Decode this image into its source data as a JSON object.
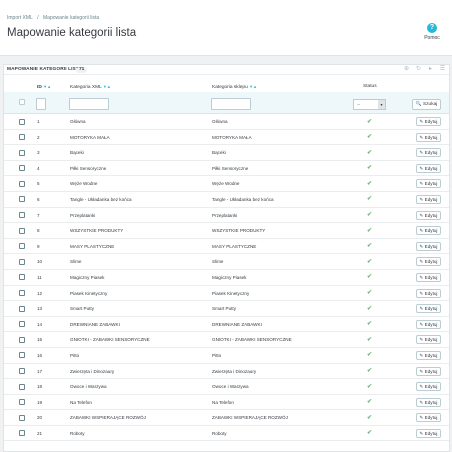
{
  "breadcrumb": [
    "Import XML",
    "/",
    "Mapowanie kategorii lista"
  ],
  "page_title": "Mapowanie kategorii lista",
  "help_label": "Pomoc",
  "panel": {
    "title": "MAPOWANIE KATEGORII LISTA",
    "count": "71"
  },
  "headers": {
    "id": "ID",
    "xml": "Kategoria XML",
    "shop": "Kategoria sklepu",
    "status": "Status",
    "sort_down": "▼",
    "sort_up": "▲"
  },
  "filter": {
    "status_value": "--",
    "search_label": "Szukaj"
  },
  "edit_label": "Edytuj",
  "colors": {
    "accent": "#25b9d7",
    "check": "#70b580"
  },
  "rows": [
    {
      "id": "1",
      "xml": "Główna",
      "shop": "Główna"
    },
    {
      "id": "2",
      "xml": "MOTORYKA MAŁA",
      "shop": "MOTORYKA MAŁA"
    },
    {
      "id": "3",
      "xml": "Bąceki",
      "shop": "Bąceki"
    },
    {
      "id": "4",
      "xml": "Piłki Sensoryczne",
      "shop": "Piłki Sensoryczne"
    },
    {
      "id": "5",
      "xml": "Węże Wodne",
      "shop": "Węże Wodne"
    },
    {
      "id": "6",
      "xml": "Tangle - Układanka bez końca",
      "shop": "Tangle - Układanka bez końca"
    },
    {
      "id": "7",
      "xml": "Przeplatanki",
      "shop": "Przeplatanki"
    },
    {
      "id": "8",
      "xml": "WSZYSTKIE PRODUKTY",
      "shop": "WSZYSTKIE PRODUKTY"
    },
    {
      "id": "9",
      "xml": "MASY PLASTYCZNE",
      "shop": "MASY PLASTYCZNE"
    },
    {
      "id": "10",
      "xml": "Slime",
      "shop": "Slime"
    },
    {
      "id": "11",
      "xml": "Magiczny Piasek",
      "shop": "Magiczny Piasek"
    },
    {
      "id": "12",
      "xml": "Piasek Kinetyczny",
      "shop": "Piasek Kinetyczny"
    },
    {
      "id": "13",
      "xml": "Smart Putty",
      "shop": "Smart Putty"
    },
    {
      "id": "14",
      "xml": "DREWNIANE ZABAWKI",
      "shop": "DREWNIANE ZABAWKI"
    },
    {
      "id": "15",
      "xml": "GNIOTKI - ZABAWKI SENSORYCZNE",
      "shop": "GNIOTKI - ZABAWKI SENSORYCZNE"
    },
    {
      "id": "16",
      "xml": "Pitto",
      "shop": "Pitto"
    },
    {
      "id": "17",
      "xml": "Zwierzęta i Dinozaury",
      "shop": "Zwierzęta i Dinozaury"
    },
    {
      "id": "18",
      "xml": "Owoce i Warzywa",
      "shop": "Owoce i Warzywa"
    },
    {
      "id": "19",
      "xml": "Na Telefon",
      "shop": "Na Telefon"
    },
    {
      "id": "20",
      "xml": "ZABAWKI WSPIERAJĄCE ROZWÓJ",
      "shop": "ZABAWKI WSPIERAJĄCE ROZWÓJ"
    },
    {
      "id": "21",
      "xml": "Roboty",
      "shop": "Roboty"
    }
  ]
}
